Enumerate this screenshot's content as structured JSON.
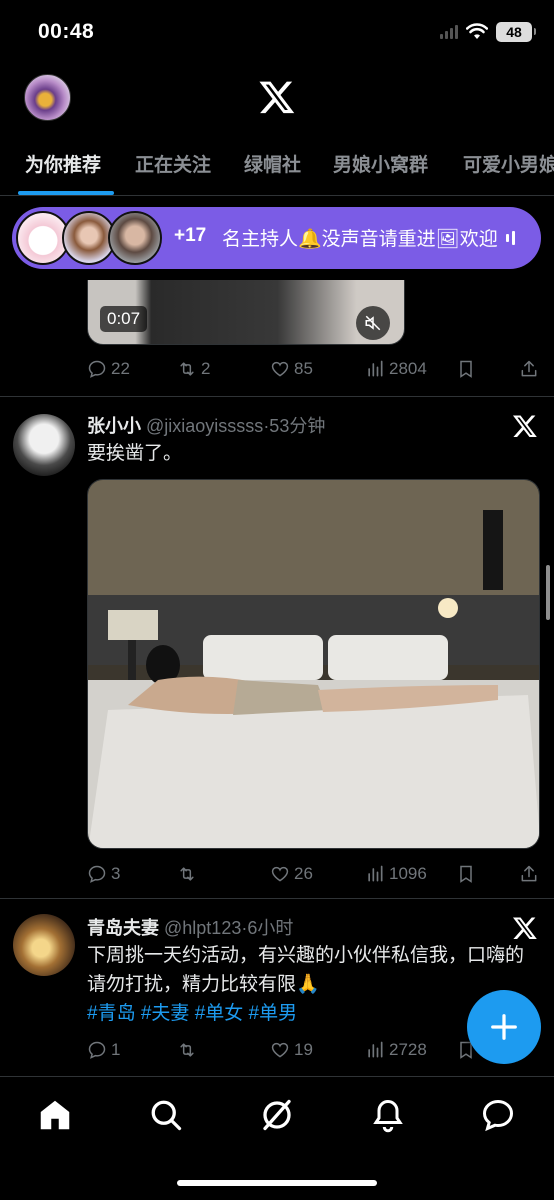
{
  "status_bar": {
    "time": "00:48",
    "battery": "48"
  },
  "tabs": [
    {
      "label": "为你推荐",
      "active": true
    },
    {
      "label": "正在关注",
      "active": false
    },
    {
      "label": "绿帽社",
      "active": false
    },
    {
      "label": "男娘小窝群",
      "active": false
    },
    {
      "label": "可爱小男娘",
      "active": false
    }
  ],
  "space": {
    "count": "+17",
    "title": "名主持人🔔没声音请重进🖼欢迎"
  },
  "tweets": [
    {
      "video_time": "0:07",
      "replies": "22",
      "retweets": "2",
      "likes": "85",
      "views": "2804"
    },
    {
      "name": "张小小",
      "handle": "@jixiaoyisssss",
      "time": "·53分钟",
      "text": "要挨凿了。",
      "replies": "3",
      "retweets": "",
      "likes": "26",
      "views": "1096"
    },
    {
      "name": "青岛夫妻",
      "handle": "@hlpt123",
      "time": "·6小时",
      "text": "下周挑一天约活动，有兴趣的小伙伴私信我，口嗨的请勿打扰，精力比较有限🙏",
      "hashtags": "#青岛 #夫妻 #单女 #单男",
      "replies": "1",
      "retweets": "",
      "likes": "19",
      "views": "2728"
    }
  ],
  "colors": {
    "accent": "#1d9bf0",
    "space": "#7b5ce6",
    "background": "#000000",
    "muted": "#71767b"
  },
  "icons": [
    "x-logo-icon",
    "reply-icon",
    "retweet-icon",
    "like-icon",
    "views-icon",
    "bookmark-icon",
    "share-icon",
    "mute-icon",
    "home-icon",
    "search-icon",
    "grok-icon",
    "bell-icon",
    "messages-icon",
    "plus-icon",
    "wifi-icon",
    "signal-icon"
  ]
}
